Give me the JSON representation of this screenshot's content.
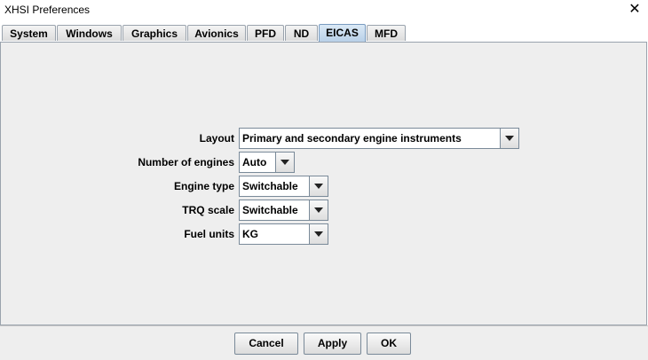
{
  "window": {
    "title": "XHSI Preferences"
  },
  "tabs": [
    {
      "label": "System"
    },
    {
      "label": "Windows"
    },
    {
      "label": "Graphics"
    },
    {
      "label": "Avionics"
    },
    {
      "label": "PFD"
    },
    {
      "label": "ND"
    },
    {
      "label": "EICAS"
    },
    {
      "label": "MFD"
    }
  ],
  "active_tab": "EICAS",
  "form": {
    "layout": {
      "label": "Layout",
      "value": "Primary and secondary engine instruments"
    },
    "engines": {
      "label": "Number of engines",
      "value": "Auto"
    },
    "engine_type": {
      "label": "Engine type",
      "value": "Switchable"
    },
    "trq_scale": {
      "label": "TRQ scale",
      "value": "Switchable"
    },
    "fuel_units": {
      "label": "Fuel units",
      "value": "KG"
    }
  },
  "buttons": {
    "cancel": "Cancel",
    "apply": "Apply",
    "ok": "OK"
  },
  "icons": {
    "close": "close-icon",
    "dropdown": "chevron-down-icon"
  }
}
